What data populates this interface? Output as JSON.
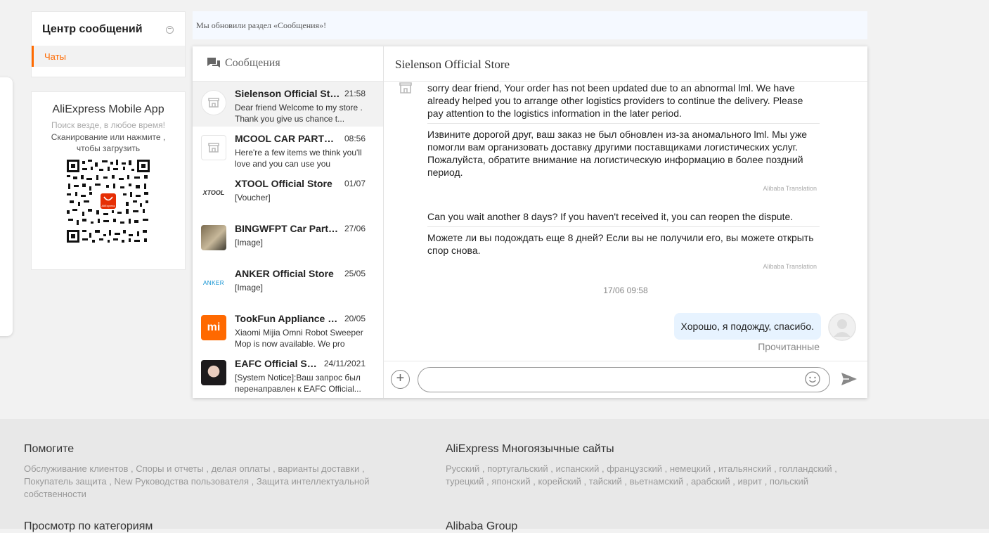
{
  "sidebar": {
    "title": "Центр сообщений",
    "collapse_symbol": "−",
    "items": [
      {
        "label": "Чаты"
      }
    ]
  },
  "app_promo": {
    "title": "AliExpress Mobile App",
    "subtitle": "Поиск везде, в любое время!",
    "description": "Сканирование или нажмите , чтобы загрузить",
    "qr_logo_text": "AliExpress"
  },
  "notice": {
    "text": "Мы обновили раздел «Сообщения»!"
  },
  "conversations": {
    "header": "Сообщения",
    "items": [
      {
        "name": "Sielenson Official Store",
        "time": "21:58",
        "preview": "Dear friend Welcome to my store . Thank you give us chance t...",
        "avatar": "store-icon"
      },
      {
        "name": "MCOOL CAR PARTS Store",
        "time": "08:56",
        "preview": "Here're a few items we think you'll love and you can use you",
        "avatar": "store-icon"
      },
      {
        "name": "XTOOL Official Store",
        "time": "01/07",
        "preview": "[Voucher]",
        "avatar": "xtool-logo",
        "logo_text": "XTOOL"
      },
      {
        "name": "BINGWFPT Car Parts Store",
        "time": "27/06",
        "preview": "[Image]",
        "avatar": "photo"
      },
      {
        "name": "ANKER Official Store",
        "time": "25/05",
        "preview": "[Image]",
        "avatar": "anker-logo",
        "logo_text": "ANKER"
      },
      {
        "name": "TookFun Appliance Store",
        "time": "20/05",
        "preview": "Xiaomi Mijia Omni Robot Sweeper Mop is now available. We pro",
        "avatar": "mi-logo",
        "logo_text": "mi"
      },
      {
        "name": "EAFC Official Store",
        "time": "24/11/2021",
        "preview": "[System Notice]:Ваш запрос был перенаправлен к EAFC Official...",
        "avatar": "photo"
      }
    ]
  },
  "chat": {
    "store_name": "Sielenson Official Store",
    "messages": [
      {
        "original": "sorry dear friend,   Your order has not been updated due to an abnormal lml. We have already helped you to arrange other logistics providers to continue the delivery. Please pay attention to the logistics information in the later period.",
        "translation": "Извините дорогой друг, ваш заказ не был обновлен из-за аномального lml. Мы уже помогли вам организовать доставку другими поставщиками логистических услуг. Пожалуйста, обратите внимание на логистическую информацию в более поздний период.",
        "translation_label": "Alibaba Translation"
      },
      {
        "original": "Can you wait another 8 days? If you haven't received it, you can reopen the dispute.",
        "translation": "Можете ли вы подождать еще 8 дней? Если вы не получили его, вы можете открыть спор снова.",
        "translation_label": "Alibaba Translation"
      }
    ],
    "timestamp": "17/06 09:58",
    "my_message": "Хорошо, я подожду, спасибо.",
    "read_status": "Прочитанные",
    "input": {
      "value": "",
      "placeholder": ""
    }
  },
  "footer": {
    "help": {
      "title": "Помогите",
      "links": "Обслуживание клиентов , Споры и отчеты , делая оплаты , варианты доставки , Покупатель защита , New Руководства пользователя , Защита интеллектуальной собственности"
    },
    "languages": {
      "title": "AliExpress Многоязычные сайты",
      "links": "Русский , португальский , испанский , французский , немецкий , итальянский , голландский , турецкий , японский , корейский , тайский , вьетнамский , арабский , иврит , польский"
    },
    "browse_title": "Просмотр по категориям",
    "group_title": "Alibaba Group"
  },
  "colors": {
    "accent": "#ff6a00",
    "my_bubble": "#e7f3ff",
    "active_conv": "#f2f2f2"
  }
}
